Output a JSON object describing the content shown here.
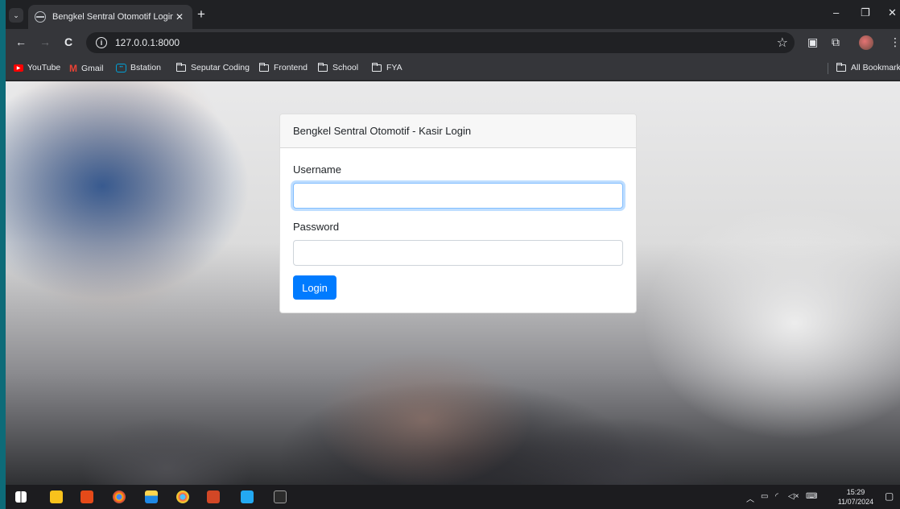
{
  "browser": {
    "tab": {
      "title": "Bengkel Sentral Otomotif Login",
      "close_label": "✕"
    },
    "new_tab_label": "+",
    "window_controls": {
      "minimize": "–",
      "restore": "❐",
      "close": "✕"
    },
    "toolbar": {
      "back_label": "←",
      "forward_label": "→",
      "reload_label": "C",
      "url": "127.0.0.1:8000",
      "star_label": "☆",
      "menu_label": "⋮"
    },
    "bookmarks": [
      {
        "label": "YouTube",
        "icon": "youtube-icon"
      },
      {
        "label": "Gmail",
        "icon": "gmail-icon"
      },
      {
        "label": "Bstation",
        "icon": "bstation-icon"
      },
      {
        "label": "Seputar Coding",
        "icon": "folder-icon"
      },
      {
        "label": "Frontend",
        "icon": "folder-icon"
      },
      {
        "label": "School",
        "icon": "folder-icon"
      },
      {
        "label": "FYA",
        "icon": "folder-icon"
      }
    ],
    "all_bookmarks_label": "All Bookmarks"
  },
  "page": {
    "card_title": "Bengkel Sentral Otomotif - Kasir Login",
    "username_label": "Username",
    "username_value": "",
    "password_label": "Password",
    "password_value": "",
    "login_button": "Login",
    "colors": {
      "primary": "#007bff",
      "focus_ring": "#80bdff"
    }
  },
  "taskbar": {
    "apps": [
      "windows-start-icon",
      "sticky-notes-icon",
      "office-icon",
      "chrome-icon",
      "file-explorer-icon",
      "chrome-active-icon",
      "powerpoint-icon",
      "vscode-icon",
      "terminal-icon"
    ],
    "time": "15:29",
    "date": "11/07/2024"
  }
}
